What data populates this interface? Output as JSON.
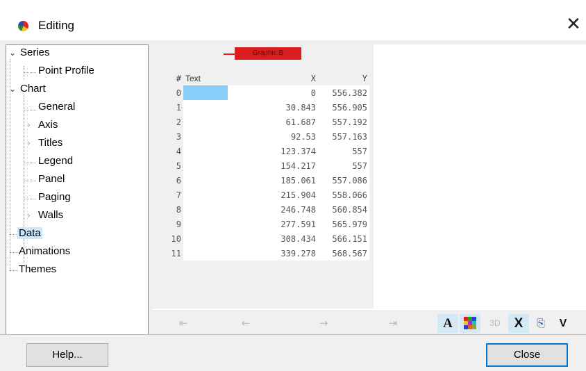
{
  "window": {
    "title": "Editing",
    "close_glyph": "✕"
  },
  "tree": [
    {
      "label": "Series",
      "expanded": true
    },
    {
      "label": "Point Profile"
    },
    {
      "label": "Chart",
      "expanded": true
    },
    {
      "label": "General"
    },
    {
      "label": "Axis",
      "expanded": false
    },
    {
      "label": "Titles",
      "expanded": false
    },
    {
      "label": "Legend"
    },
    {
      "label": "Panel"
    },
    {
      "label": "Paging"
    },
    {
      "label": "Walls",
      "expanded": false
    },
    {
      "label": "Data",
      "selected": true
    },
    {
      "label": "Animations"
    },
    {
      "label": "Themes"
    }
  ],
  "grid": {
    "series_label": "Graphic B",
    "headers": {
      "num": "#",
      "text": "Text",
      "x": "X",
      "y": "Y"
    },
    "rows": [
      {
        "num": "0",
        "text": "",
        "x": "0",
        "y": "556.382"
      },
      {
        "num": "1",
        "text": "",
        "x": "30.843",
        "y": "556.905"
      },
      {
        "num": "2",
        "text": "",
        "x": "61.687",
        "y": "557.192"
      },
      {
        "num": "3",
        "text": "",
        "x": "92.53",
        "y": "557.163"
      },
      {
        "num": "4",
        "text": "",
        "x": "123.374",
        "y": "557"
      },
      {
        "num": "5",
        "text": "",
        "x": "154.217",
        "y": "557"
      },
      {
        "num": "6",
        "text": "",
        "x": "185.061",
        "y": "557.086"
      },
      {
        "num": "7",
        "text": "",
        "x": "215.904",
        "y": "558.066"
      },
      {
        "num": "8",
        "text": "",
        "x": "246.748",
        "y": "560.854"
      },
      {
        "num": "9",
        "text": "",
        "x": "277.591",
        "y": "565.979"
      },
      {
        "num": "10",
        "text": "",
        "x": "308.434",
        "y": "566.151"
      },
      {
        "num": "11",
        "text": "",
        "x": "339.278",
        "y": "568.567"
      }
    ]
  },
  "toolbar": {
    "first_glyph": "⇤",
    "prev_glyph": "←",
    "next_glyph": "→",
    "last_glyph": "⇥",
    "font_label": "A",
    "threed_label": "3D",
    "delete_label": "X",
    "copy_glyph": "⎘",
    "more_label": "V"
  },
  "buttons": {
    "help": "Help...",
    "close": "Close"
  },
  "colors": {
    "accent": "#0078d7",
    "selection": "#cce8ff",
    "active_cell": "#87cefa",
    "series": "#d81e1e"
  }
}
